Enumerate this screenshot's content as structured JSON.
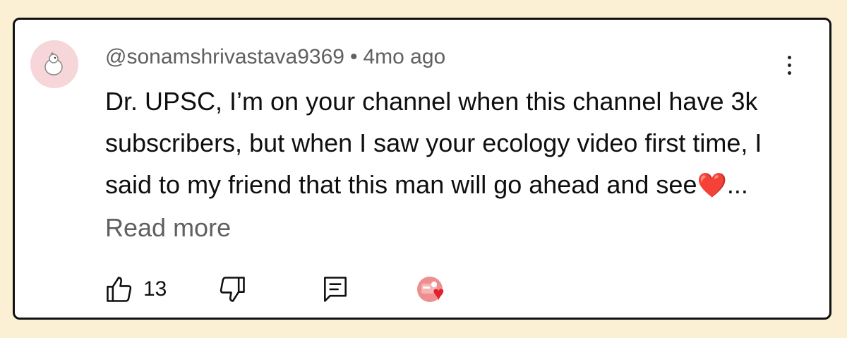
{
  "comment": {
    "author": "@sonamshrivastava9369",
    "separator": "•",
    "time": "4mo ago",
    "text": "Dr. UPSC, I’m on your channel when this channel have 3k subscribers, but when I saw your ecology video first time, I said to my friend that this man will go ahead and see",
    "heart_emoji": "❤️",
    "ellipsis": "...",
    "read_more": "Read more"
  },
  "actions": {
    "like_count": "13"
  },
  "icons": {
    "avatar": "chick-avatar-icon",
    "menu": "more-vertical-icon",
    "like": "thumbs-up-icon",
    "dislike": "thumbs-down-icon",
    "reply": "comment-reply-icon",
    "creator_heart": "creator-heart-icon"
  },
  "colors": {
    "page_background": "#fbf0d4",
    "card_border": "#111111",
    "secondary_text": "#606060",
    "heart": "#e3202b",
    "avatar_background": "#f7d6d9"
  }
}
